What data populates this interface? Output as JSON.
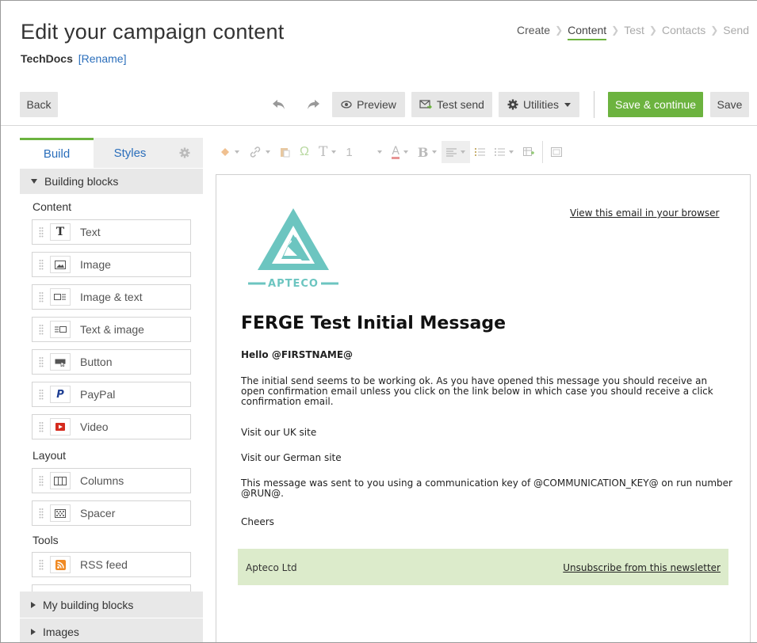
{
  "header": {
    "title": "Edit your campaign content",
    "campaign_name": "TechDocs",
    "rename_label": "[Rename]"
  },
  "steps": [
    {
      "label": "Create",
      "state": "done"
    },
    {
      "label": "Content",
      "state": "active"
    },
    {
      "label": "Test",
      "state": "upcoming"
    },
    {
      "label": "Contacts",
      "state": "upcoming"
    },
    {
      "label": "Send",
      "state": "upcoming"
    }
  ],
  "toolbar": {
    "back_label": "Back",
    "preview_label": "Preview",
    "test_send_label": "Test send",
    "utilities_label": "Utilities",
    "save_continue_label": "Save & continue",
    "save_label": "Save"
  },
  "sidebar": {
    "tabs": [
      "Build",
      "Styles"
    ],
    "building_blocks_label": "Building blocks",
    "groups": {
      "content": "Content",
      "layout": "Layout",
      "tools": "Tools"
    },
    "blocks": [
      {
        "label": "Text",
        "icon": "text-icon"
      },
      {
        "label": "Image",
        "icon": "image-icon"
      },
      {
        "label": "Image & text",
        "icon": "image-text-icon"
      },
      {
        "label": "Text & image",
        "icon": "text-image-icon"
      },
      {
        "label": "Button",
        "icon": "button-icon"
      },
      {
        "label": "PayPal",
        "icon": "paypal-icon"
      },
      {
        "label": "Video",
        "icon": "video-icon"
      },
      {
        "label": "Columns",
        "icon": "columns-icon"
      },
      {
        "label": "Spacer",
        "icon": "spacer-icon"
      },
      {
        "label": "RSS feed",
        "icon": "rss-icon"
      }
    ],
    "my_blocks_label": "My building blocks",
    "images_label": "Images"
  },
  "editor_toolbar": {
    "font_size_value": "1"
  },
  "email": {
    "view_in_browser": "View this email in your browser",
    "logo_text": "APTECO",
    "heading": "FERGE Test Initial Message",
    "greeting": "Hello @FIRSTNAME@",
    "body_lines": [
      "The initial send seems to be working ok. As you have opened this message you should receive an",
      "open confirmation email unless you click on the link below in which case you should receive a click",
      "confirmation email."
    ],
    "link_uk": "Visit our UK site",
    "link_german": "Visit our German site",
    "key_lines": [
      "This message was sent to you using a communication key of @COMMUNICATION_KEY@ on run number",
      "@RUN@."
    ],
    "signoff": "Cheers",
    "footer_company": "Apteco Ltd",
    "footer_unsubscribe": "Unsubscribe from this newsletter"
  },
  "colors": {
    "accent_green": "#6cb33f",
    "link_blue": "#2a6ebb",
    "logo_teal": "#6cc5c0",
    "footer_bg": "#dcebcb"
  }
}
